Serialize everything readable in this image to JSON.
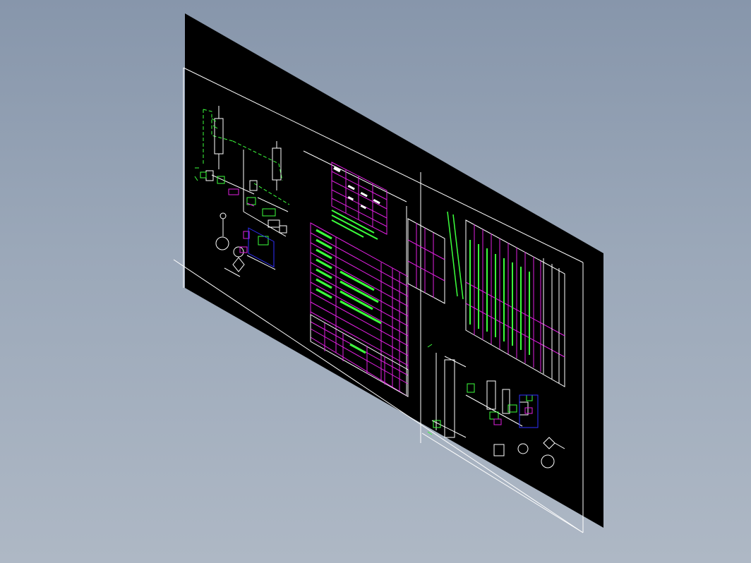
{
  "viewport": {
    "background_top": "#8796ab",
    "background_bottom": "#aeb8c5"
  },
  "drawing": {
    "sheet_color": "#000000",
    "frame_color": "#ffffff",
    "line_colors": {
      "green": "#3cff3c",
      "magenta": "#e020e0",
      "blue": "#3030ff",
      "white": "#ffffff"
    }
  }
}
